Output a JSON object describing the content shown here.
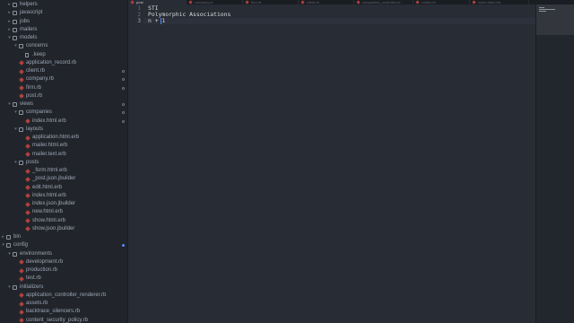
{
  "sidebar": {
    "items": [
      {
        "label": "helpers",
        "kind": "folder",
        "depth": 1,
        "open": false
      },
      {
        "label": "javascript",
        "kind": "folder",
        "depth": 1,
        "open": false
      },
      {
        "label": "jobs",
        "kind": "folder",
        "depth": 1,
        "open": false
      },
      {
        "label": "mailers",
        "kind": "folder",
        "depth": 1,
        "open": false
      },
      {
        "label": "models",
        "kind": "folder",
        "depth": 1,
        "open": true
      },
      {
        "label": "concerns",
        "kind": "folder",
        "depth": 2,
        "open": true
      },
      {
        "label": ".keep",
        "kind": "file",
        "depth": 3
      },
      {
        "label": "application_record.rb",
        "kind": "ruby",
        "depth": 2
      },
      {
        "label": "client.rb",
        "kind": "ruby",
        "depth": 2,
        "mark": "dot"
      },
      {
        "label": "company.rb",
        "kind": "ruby",
        "depth": 2,
        "mark": "dot"
      },
      {
        "label": "firm.rb",
        "kind": "ruby",
        "depth": 2,
        "mark": "dot"
      },
      {
        "label": "post.rb",
        "kind": "ruby",
        "depth": 2
      },
      {
        "label": "views",
        "kind": "folder",
        "depth": 1,
        "open": true,
        "mark": "dot"
      },
      {
        "label": "companies",
        "kind": "folder",
        "depth": 2,
        "open": true,
        "mark": "dot"
      },
      {
        "label": "index.html.erb",
        "kind": "ruby",
        "depth": 3,
        "mark": "dot"
      },
      {
        "label": "layouts",
        "kind": "folder",
        "depth": 2,
        "open": true
      },
      {
        "label": "application.html.erb",
        "kind": "ruby",
        "depth": 3
      },
      {
        "label": "mailer.html.erb",
        "kind": "ruby",
        "depth": 3
      },
      {
        "label": "mailer.text.erb",
        "kind": "ruby",
        "depth": 3
      },
      {
        "label": "posts",
        "kind": "folder",
        "depth": 2,
        "open": true
      },
      {
        "label": "_form.html.erb",
        "kind": "ruby",
        "depth": 3
      },
      {
        "label": "_post.json.jbuilder",
        "kind": "ruby",
        "depth": 3
      },
      {
        "label": "edit.html.erb",
        "kind": "ruby",
        "depth": 3
      },
      {
        "label": "index.html.erb",
        "kind": "ruby",
        "depth": 3
      },
      {
        "label": "index.json.jbuilder",
        "kind": "ruby",
        "depth": 3
      },
      {
        "label": "new.html.erb",
        "kind": "ruby",
        "depth": 3
      },
      {
        "label": "show.html.erb",
        "kind": "ruby",
        "depth": 3
      },
      {
        "label": "show.json.jbuilder",
        "kind": "ruby",
        "depth": 3
      },
      {
        "label": "bin",
        "kind": "folder",
        "depth": 0,
        "open": false
      },
      {
        "label": "config",
        "kind": "folder",
        "depth": 0,
        "open": true,
        "mark": "blue"
      },
      {
        "label": "environments",
        "kind": "folder",
        "depth": 1,
        "open": true
      },
      {
        "label": "development.rb",
        "kind": "ruby",
        "depth": 2
      },
      {
        "label": "production.rb",
        "kind": "ruby",
        "depth": 2
      },
      {
        "label": "test.rb",
        "kind": "ruby",
        "depth": 2
      },
      {
        "label": "initializers",
        "kind": "folder",
        "depth": 1,
        "open": true
      },
      {
        "label": "application_controller_renderer.rb",
        "kind": "ruby",
        "depth": 2
      },
      {
        "label": "assets.rb",
        "kind": "ruby",
        "depth": 2
      },
      {
        "label": "backtrace_silencers.rb",
        "kind": "ruby",
        "depth": 2
      },
      {
        "label": "content_security_policy.rb",
        "kind": "ruby",
        "depth": 2
      }
    ]
  },
  "tabs": [
    {
      "label": "post"
    },
    {
      "label": "company.rb"
    },
    {
      "label": "firm.rb"
    },
    {
      "label": "client.rb"
    },
    {
      "label": "companies_controller.rb"
    },
    {
      "label": "routes.rb"
    },
    {
      "label": "index.html.erb"
    }
  ],
  "active_tab": 0,
  "editor": {
    "line_numbers": [
      "1",
      "2",
      "3"
    ],
    "lines": [
      "STI",
      "Polymorphic Associations",
      "n + 1"
    ],
    "cursor_line": 3
  },
  "colors": {
    "accent": "#528bff",
    "ruby_icon": "#b0413e",
    "editor_bg": "#282c34",
    "sidebar_bg": "#21252b"
  }
}
